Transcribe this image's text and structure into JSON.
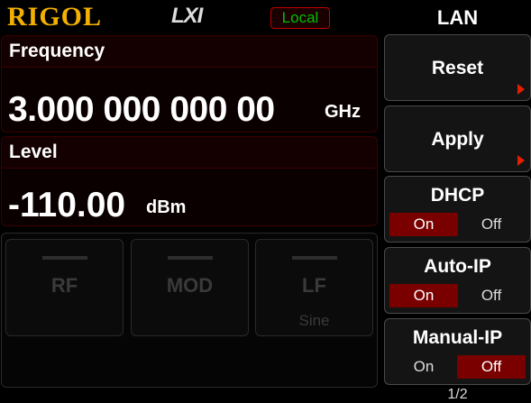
{
  "header": {
    "brand": "RIGOL",
    "lxi": "LXI",
    "mode": "Local",
    "menu_title": "LAN"
  },
  "frequency": {
    "label": "Frequency",
    "value": "3.000 000 000 00",
    "unit": "GHz"
  },
  "level": {
    "label": "Level",
    "value": "-110.00",
    "unit": "dBm"
  },
  "modules": [
    {
      "name": "RF",
      "sub": ""
    },
    {
      "name": "MOD",
      "sub": ""
    },
    {
      "name": "LF",
      "sub": "Sine"
    }
  ],
  "softkeys": {
    "reset": {
      "label": "Reset"
    },
    "apply": {
      "label": "Apply"
    },
    "dhcp": {
      "label": "DHCP",
      "on": "On",
      "off": "Off",
      "selected": "on"
    },
    "auto_ip": {
      "label": "Auto-IP",
      "on": "On",
      "off": "Off",
      "selected": "on"
    },
    "manual_ip": {
      "label": "Manual-IP",
      "on": "On",
      "off": "Off",
      "selected": "off"
    }
  },
  "page_indicator": "1/2",
  "colors": {
    "brand": "#f2b000",
    "local_text": "#00c000",
    "selected_option": "#7a0000",
    "arrow": "#e02000"
  }
}
